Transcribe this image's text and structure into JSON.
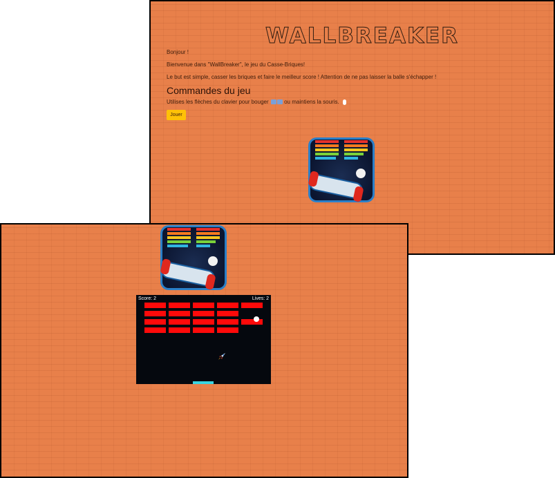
{
  "home_page": {
    "logo_text": "WALLBREAKER",
    "greeting": "Bonjour !",
    "welcome": "Bienvenue dans \"WallBreaker\", le jeu du Casse-Briques!",
    "goal": "Le but est simple, casser les briques et faire le meilleur score ! Attention de ne pas laisser la balle s'échapper !",
    "controls_heading": "Commandes du jeu",
    "controls_text_before": "Utilises les flèches du clavier pour bouger",
    "controls_text_after": "ou maintiens la souris.",
    "play_button": "Jouer",
    "icons": [
      "left-arrow-key-icon",
      "right-arrow-key-icon",
      "mouse-icon",
      "breakout-app-icon"
    ]
  },
  "game_page": {
    "score_label": "Score: 2",
    "lives_label": "Lives: 2",
    "icons": [
      "breakout-app-icon",
      "rocket-icon"
    ],
    "brick_rows": [
      [
        1,
        1,
        1,
        1,
        1
      ],
      [
        1,
        1,
        1,
        1,
        0
      ],
      [
        1,
        1,
        1,
        1,
        1
      ],
      [
        1,
        1,
        1,
        1,
        0
      ]
    ]
  },
  "colors": {
    "background": "#e8804a",
    "brick": "#ff0a0a",
    "paddle": "#39d4e0",
    "play_button": "#ffc107",
    "game_canvas": "#05080e"
  }
}
